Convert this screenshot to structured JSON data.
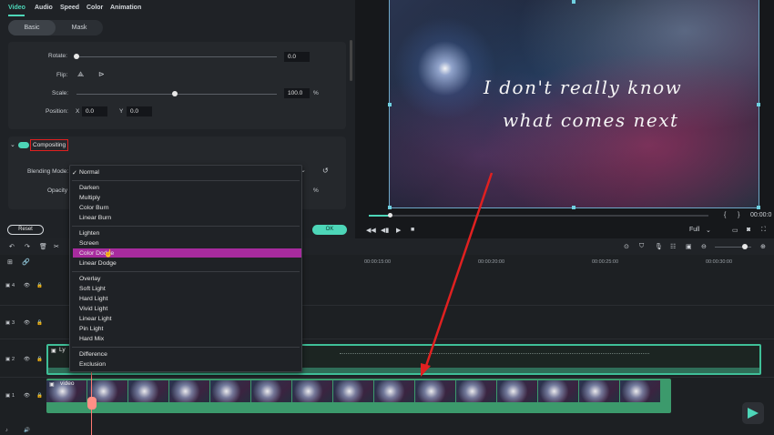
{
  "inspector": {
    "tabs": [
      "Video",
      "Audio",
      "Speed",
      "Color",
      "Animation"
    ],
    "subtabs": [
      "Basic",
      "Mask"
    ],
    "rotate": {
      "label": "Rotate:",
      "value": "0.0",
      "fraction": 0
    },
    "flip": {
      "label": "Flip:"
    },
    "scale": {
      "label": "Scale:",
      "value": "100.0",
      "unit": "%",
      "fraction": 0.49
    },
    "position": {
      "label": "Position:",
      "x_label": "X",
      "x_value": "0.0",
      "y_label": "Y",
      "y_value": "0.0"
    },
    "compositing": {
      "label": "Compositing",
      "enabled": true
    },
    "blending_mode_label": "Blending Mode:",
    "opacity_label": "Opacity",
    "opacity_unit": "%",
    "reset_label": "Reset",
    "ok_label": "OK"
  },
  "dropdown": {
    "selected": "Normal",
    "groups": [
      [
        "Normal"
      ],
      [
        "Darken",
        "Multiply",
        "Color Burn",
        "Linear Burn"
      ],
      [
        "Lighten",
        "Screen",
        "Color Dodge",
        "Linear Dodge"
      ],
      [
        "Overlay",
        "Soft Light",
        "Hard Light",
        "Vivid Light",
        "Linear Light",
        "Pin Light",
        "Hard Mix"
      ],
      [
        "Difference",
        "Exclusion"
      ]
    ],
    "hovered": "Color Dodge"
  },
  "preview": {
    "lyric_line1": "I don't really know",
    "lyric_line2": "what comes next",
    "quality": "Full",
    "timecode": "00:00:0"
  },
  "timeline": {
    "ruler": [
      "00:00:15:00",
      "00:00:20:00",
      "00:00:25:00",
      "00:00:30:00"
    ],
    "tracks": [
      "4",
      "3",
      "2",
      "1"
    ],
    "lyric_clip_label": "Ly",
    "video_clip_label": "video"
  },
  "colors": {
    "accent": "#4dd6b8",
    "highlight": "#a72b9e",
    "annotation_red": "#e02020"
  }
}
